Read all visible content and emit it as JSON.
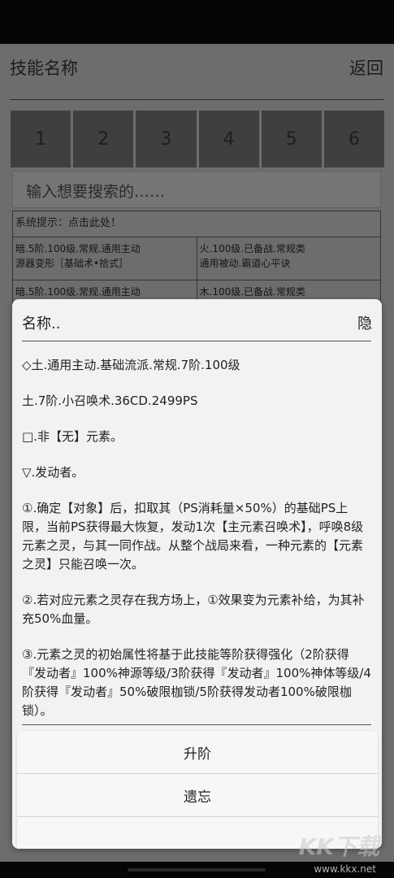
{
  "header": {
    "title": "技能名称",
    "back": "返回"
  },
  "tabs": [
    "1",
    "2",
    "3",
    "4",
    "5",
    "6"
  ],
  "search": {
    "placeholder": "输入想要搜索的……"
  },
  "hint": "系统提示：点击此处！",
  "skills": [
    [
      "暗.5阶.100级.常规.通用主动\n源器变形［基础术•拾式］",
      "火.100级.已备战.常规类\n通用被动.霸道心平诀"
    ],
    [
      "暗.5阶.100级.常规.通用主动",
      "木.100级.已备战.常规类"
    ]
  ],
  "dialog": {
    "title": "名称..",
    "hide": "隐",
    "paragraphs": [
      "◇土.通用主动.基础流派.常规.7阶.100级",
      "土.7阶.小召唤术.36CD.2499PS",
      "□.非【无】元素。",
      "▽.发动者。",
      "①.确定【对象】后，扣取其（PS消耗量×50%）的基础PS上限，当前PS获得最大恢复，发动1次【主元素召唤术】，呼唤8级元素之灵，与其一同作战。从整个战局来看，一种元素的【元素之灵】只能召唤一次。",
      "②.若对应元素之灵存在我方场上，①效果变为元素补给，为其补充50%血量。",
      "③.元素之灵的初始属性将基于此技能等阶获得强化（2阶获得『发动者』100%神源等级/3阶获得『发动者』100%神体等级/4阶获得『发动者』50%破限枷锁/5阶获得发动者100%破限枷锁）。"
    ],
    "actions": {
      "upgrade": "升阶",
      "forget": "遗忘",
      "extra": ""
    }
  },
  "watermark": {
    "logo": "KK下载",
    "url": "www.kkx.net"
  }
}
